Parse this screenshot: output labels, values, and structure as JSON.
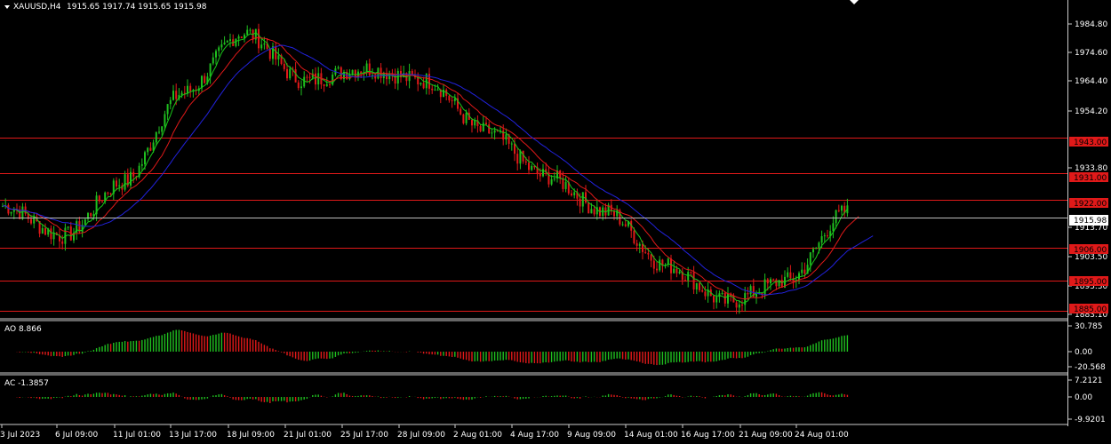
{
  "header": {
    "symbol_label": "XAUUSD,H4",
    "ohlc_label": "1915.65 1917.74 1915.65 1915.98"
  },
  "price_axis": {
    "ticks": [
      "1984.80",
      "1974.60",
      "1964.40",
      "1954.20",
      "1933.80",
      "1913.70",
      "1903.50",
      "1893.30",
      "1883.10"
    ],
    "current_price_label": "1915.98"
  },
  "levels": {
    "labels": [
      "1943.00",
      "1931.00",
      "1922.00",
      "1906.00",
      "1895.00",
      "1885.00"
    ]
  },
  "indicators": {
    "ao": {
      "label": "AO 8.866",
      "max_label": "30.785",
      "zero_label": "0.00",
      "min_label": "-20.568"
    },
    "ac": {
      "label": "AC -1.3857",
      "max_label": "7.2121",
      "zero_label": "0.00",
      "min_label": "-9.9201"
    }
  },
  "time_axis": {
    "labels": [
      "3 Jul 2023",
      "6 Jul 09:00",
      "11 Jul 01:00",
      "13 Jul 17:00",
      "18 Jul 09:00",
      "21 Jul 01:00",
      "25 Jul 17:00",
      "28 Jul 09:00",
      "2 Aug 01:00",
      "4 Aug 17:00",
      "9 Aug 09:00",
      "14 Aug 01:00",
      "16 Aug 17:00",
      "21 Aug 09:00",
      "24 Aug 01:00"
    ]
  },
  "chart_data": {
    "type": "line",
    "title": "XAUUSD,H4",
    "x": [
      "3 Jul 2023",
      "6 Jul 09:00",
      "11 Jul 01:00",
      "13 Jul 17:00",
      "18 Jul 09:00",
      "21 Jul 01:00",
      "25 Jul 17:00",
      "28 Jul 09:00",
      "2 Aug 01:00",
      "4 Aug 17:00",
      "9 Aug 09:00",
      "14 Aug 01:00",
      "16 Aug 17:00",
      "21 Aug 09:00",
      "24 Aug 01:00"
    ],
    "series": [
      {
        "values": [
          1920,
          1910,
          1928,
          1958,
          1978,
          1962,
          1966,
          1962,
          1945,
          1930,
          1918,
          1900,
          1888,
          1895,
          1918
        ]
      }
    ],
    "ylim": [
      1883.1,
      1989.0
    ],
    "grid": false,
    "current_price": 1915.98,
    "horizontal_levels": [
      1943.0,
      1931.0,
      1922.0,
      1906.0,
      1895.0,
      1885.0
    ],
    "colors": {
      "up_candle": "#1fbf1f",
      "down_candle": "#e01919",
      "ma_fast": "#19c819",
      "ma_mid": "#e01919",
      "ma_slow": "#2222dd",
      "level_line": "#e01919",
      "level_label_bg": "#e01919",
      "current_price_line": "#bbbbbb",
      "current_price_label_bg": "#ffffff",
      "axis_text": "#ffffff",
      "separator": "#cccccc"
    }
  }
}
